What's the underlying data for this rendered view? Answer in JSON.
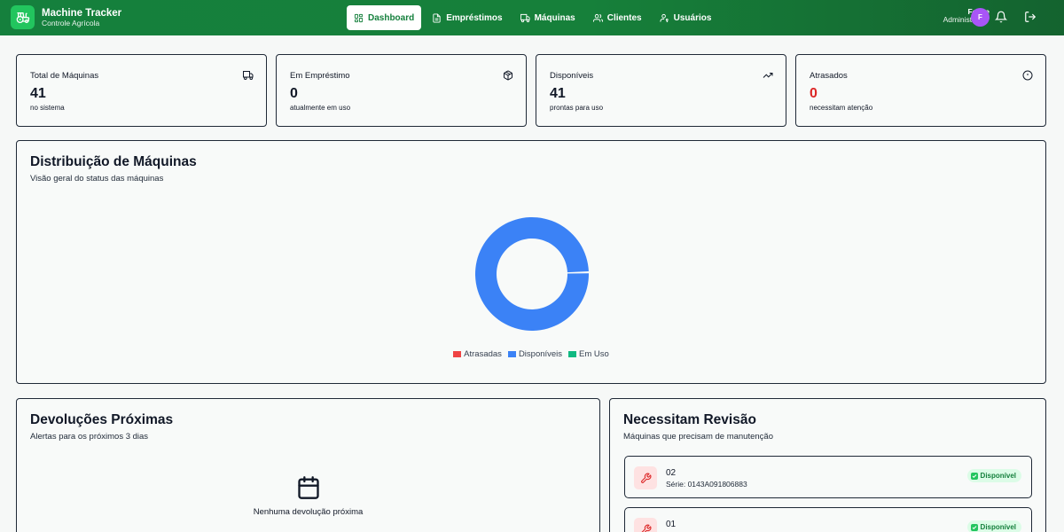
{
  "header": {
    "brand_title": "Machine Tracker",
    "brand_subtitle": "Controle Agrícola",
    "nav": [
      {
        "label": "Dashboard",
        "icon": "grid-icon",
        "active": true
      },
      {
        "label": "Empréstimos",
        "icon": "document-icon"
      },
      {
        "label": "Máquinas",
        "icon": "truck-icon"
      },
      {
        "label": "Clientes",
        "icon": "users-icon"
      },
      {
        "label": "Usuários",
        "icon": "user-key-icon"
      }
    ],
    "user_name": "Felipe",
    "user_role": "Administrador",
    "avatar_initial": "F"
  },
  "stats": [
    {
      "title": "Total de Máquinas",
      "value": "41",
      "note": "no sistema",
      "icon": "truck-icon"
    },
    {
      "title": "Em Empréstimo",
      "value": "0",
      "note": "atualmente em uso",
      "icon": "package-icon"
    },
    {
      "title": "Disponíveis",
      "value": "41",
      "note": "prontas para uso",
      "icon": "trending-up-icon"
    },
    {
      "title": "Atrasados",
      "value": "0",
      "note": "necessitam atenção",
      "icon": "alert-circle-icon",
      "value_color": "#dc2626"
    }
  ],
  "distribution": {
    "title": "Distribuição de Máquinas",
    "subtitle": "Visão geral do status das máquinas"
  },
  "chart_data": {
    "type": "pie",
    "categories": [
      "Atrasadas",
      "Disponíveis",
      "Em Uso"
    ],
    "values": [
      0,
      41,
      0
    ],
    "colors": [
      "#ef4444",
      "#3b82f6",
      "#10b981"
    ],
    "legend_position": "bottom"
  },
  "upcoming": {
    "title": "Devoluções Próximas",
    "subtitle": "Alertas para os próximos 3 dias",
    "empty_text": "Nenhuma devolução próxima"
  },
  "revision": {
    "title": "Necessitam Revisão",
    "subtitle": "Máquinas que precisam de manutenção",
    "items": [
      {
        "name": "02",
        "serial": "Série: 0143A091806883",
        "status": "Disponível"
      },
      {
        "name": "01",
        "serial": "",
        "status": "Disponível"
      }
    ]
  },
  "colors": {
    "header_green": "#15803d",
    "brand_green": "#22c55e",
    "avatar_purple": "#a855f7",
    "danger_red": "#dc2626"
  }
}
